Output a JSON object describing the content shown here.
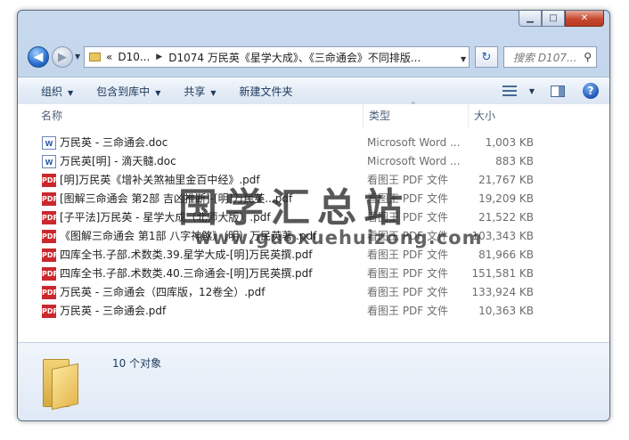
{
  "window": {
    "controls": {
      "minimize": "▁",
      "maximize": "□",
      "close": "✕"
    }
  },
  "nav": {
    "back": "◀",
    "forward": "▶"
  },
  "address": {
    "prefix": "«",
    "crumbs": [
      "D10...",
      "D1074 万民英《星学大成》、《三命通会》不同排版..."
    ]
  },
  "search": {
    "placeholder": "搜索 D107..."
  },
  "toolbar": {
    "organize": "组织",
    "include_in_library": "包含到库中",
    "share": "共享",
    "new_folder": "新建文件夹"
  },
  "columns": {
    "name": "名称",
    "type": "类型",
    "size": "大小"
  },
  "files": [
    {
      "icon": "doc",
      "name": "万民英 - 三命通会.doc",
      "type": "Microsoft Word ...",
      "size": "1,003 KB"
    },
    {
      "icon": "doc",
      "name": "万民英[明] - 滴天髓.doc",
      "type": "Microsoft Word ...",
      "size": "883 KB"
    },
    {
      "icon": "pdf",
      "name": "[明]万民英《增补关煞袖里金百中经》.pdf",
      "type": "看图王 PDF 文件",
      "size": "21,767 KB"
    },
    {
      "icon": "pdf",
      "name": "[图解三命通会 第2部 吉凶推断]-[明]万民英...pdf",
      "type": "看图王 PDF 文件",
      "size": "19,209 KB"
    },
    {
      "icon": "pdf",
      "name": "[子平法]万民英 - 星学大成（北师大版）.pdf",
      "type": "看图王 PDF 文件",
      "size": "21,522 KB"
    },
    {
      "icon": "pdf",
      "name": "《图解三命通会 第1部 八字神煞》（明）万民英著 .pdf",
      "type": "看图王 PDF 文件",
      "size": "103,343 KB"
    },
    {
      "icon": "pdf",
      "name": "四库全书.子部.术数类.39.星学大成-[明]万民英撰.pdf",
      "type": "看图王 PDF 文件",
      "size": "81,966 KB"
    },
    {
      "icon": "pdf",
      "name": "四库全书.子部.术数类.40.三命通会-[明]万民英撰.pdf",
      "type": "看图王 PDF 文件",
      "size": "151,581 KB"
    },
    {
      "icon": "pdf",
      "name": "万民英 - 三命通会（四库版，12卷全）.pdf",
      "type": "看图王 PDF 文件",
      "size": "133,924 KB"
    },
    {
      "icon": "pdf",
      "name": "万民英 - 三命通会.pdf",
      "type": "看图王 PDF 文件",
      "size": "10,363 KB"
    }
  ],
  "icon_labels": {
    "doc": "W",
    "pdf": "PDF"
  },
  "watermark": {
    "line1": "国学汇总站",
    "line2": "www.guoxuehuizong.com"
  },
  "status": {
    "count": "10 个对象"
  }
}
